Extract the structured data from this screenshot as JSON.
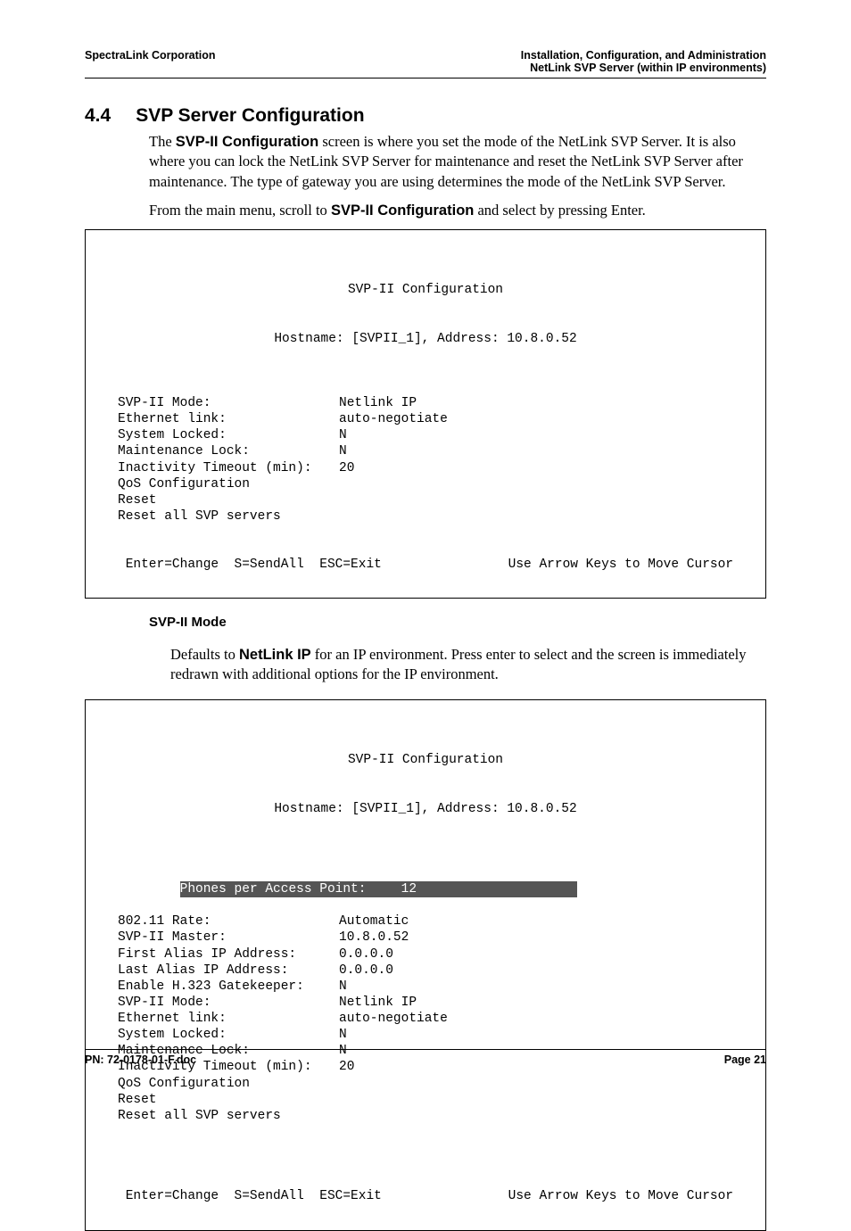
{
  "header": {
    "left": "SpectraLink Corporation",
    "right_line1": "Installation, Configuration, and Administration",
    "right_line2": "NetLink SVP Server (within IP environments)"
  },
  "section": {
    "number": "4.4",
    "title": "SVP Server Configuration"
  },
  "para1_a": "The ",
  "para1_bold": "SVP-II Configuration",
  "para1_b": " screen is where you set the mode of the NetLink SVP Server. It is also where you can lock the NetLink SVP Server for maintenance and reset the NetLink SVP Server after maintenance. The type of gateway you are using determines the mode of the NetLink SVP Server.",
  "para2_a": "From the main menu, scroll to ",
  "para2_bold": "SVP-II Configuration",
  "para2_b": " and select by pressing Enter.",
  "terminal1": {
    "title": "SVP-II Configuration",
    "hostline": "Hostname: [SVPII_1], Address: 10.8.0.52",
    "rows": [
      {
        "label": "SVP-II Mode:",
        "value": "Netlink IP"
      },
      {
        "label": "Ethernet link:",
        "value": "auto-negotiate"
      },
      {
        "label": "System Locked:",
        "value": "N"
      },
      {
        "label": "Maintenance Lock:",
        "value": "N"
      },
      {
        "label": "Inactivity Timeout (min):",
        "value": "20"
      },
      {
        "label": "QoS Configuration",
        "value": ""
      },
      {
        "label": "Reset",
        "value": ""
      },
      {
        "label": "Reset all SVP servers",
        "value": ""
      }
    ],
    "footer_left": " Enter=Change  S=SendAll  ESC=Exit",
    "footer_right": "Use Arrow Keys to Move Cursor"
  },
  "subhead1": "SVP-II Mode",
  "para3_a": "Defaults to ",
  "para3_bold": "NetLink IP",
  "para3_b": " for an IP environment. Press enter to select and the screen is immediately redrawn with additional options for the IP environment.",
  "terminal2": {
    "title": "SVP-II Configuration",
    "hostline": "Hostname: [SVPII_1], Address: 10.8.0.52",
    "highlight_row": {
      "label": "Phones per Access Point:",
      "value": "12"
    },
    "rows": [
      {
        "label": "802.11 Rate:",
        "value": "Automatic"
      },
      {
        "label": "SVP-II Master:",
        "value": "10.8.0.52"
      },
      {
        "label": "First Alias IP Address:",
        "value": "0.0.0.0"
      },
      {
        "label": "Last Alias IP Address:",
        "value": "0.0.0.0"
      },
      {
        "label": "Enable H.323 Gatekeeper:",
        "value": "N"
      },
      {
        "label": "SVP-II Mode:",
        "value": "Netlink IP"
      },
      {
        "label": "Ethernet link:",
        "value": "auto-negotiate"
      },
      {
        "label": "System Locked:",
        "value": "N"
      },
      {
        "label": "Maintenance Lock:",
        "value": "N"
      },
      {
        "label": "Inactivity Timeout (min):",
        "value": "20"
      },
      {
        "label": "QoS Configuration",
        "value": ""
      },
      {
        "label": "Reset",
        "value": ""
      },
      {
        "label": "Reset all SVP servers",
        "value": ""
      }
    ],
    "footer_left": " Enter=Change  S=SendAll  ESC=Exit",
    "footer_right": "Use Arrow Keys to Move Cursor"
  },
  "footer": {
    "left": "PN: 72-0178-01-F.doc",
    "right": "Page 21"
  }
}
